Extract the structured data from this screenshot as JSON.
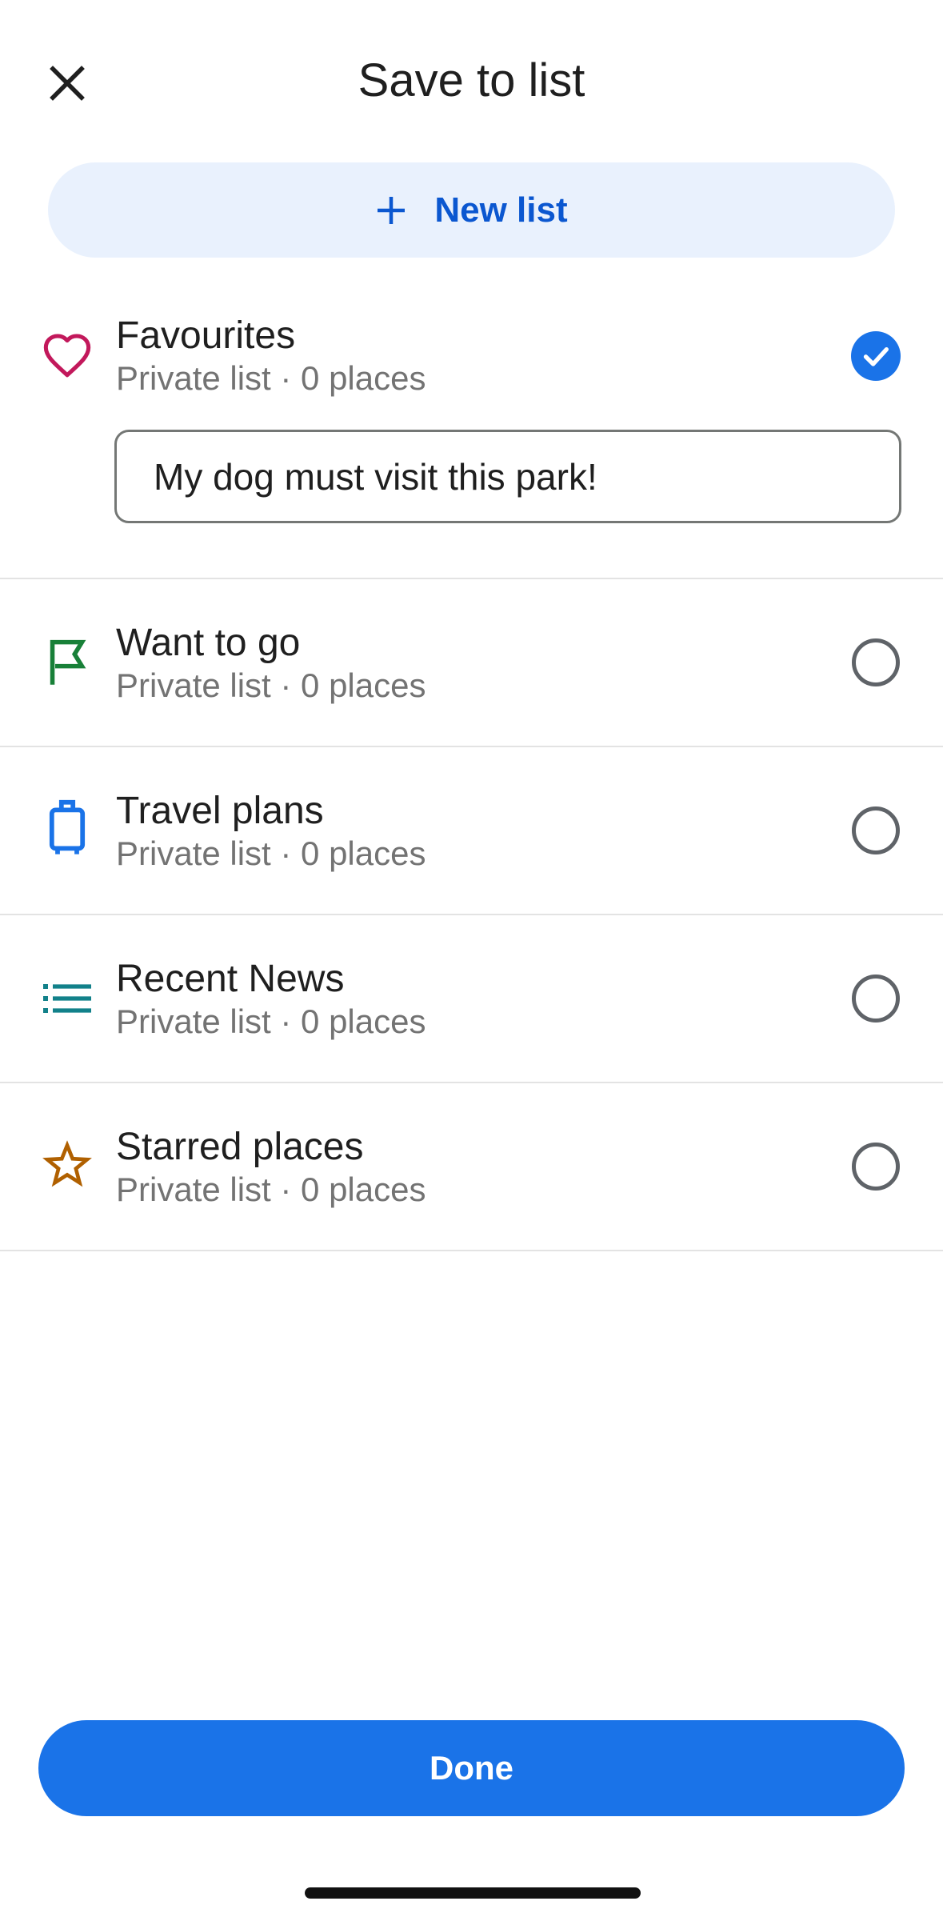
{
  "header": {
    "title": "Save to list",
    "close_icon": "close-icon"
  },
  "new_list": {
    "label": "New list",
    "icon": "plus-icon"
  },
  "lists": [
    {
      "name": "Favourites",
      "subtitle": "Private list · 0 places",
      "icon": "heart-icon",
      "icon_color": "#c2185b",
      "selected": true,
      "note": "My dog must visit this park!"
    },
    {
      "name": "Want to go",
      "subtitle": "Private list · 0 places",
      "icon": "flag-icon",
      "icon_color": "#188038",
      "selected": false
    },
    {
      "name": "Travel plans",
      "subtitle": "Private list · 0 places",
      "icon": "suitcase-icon",
      "icon_color": "#1a73e8",
      "selected": false
    },
    {
      "name": "Recent News",
      "subtitle": "Private list · 0 places",
      "icon": "list-icon",
      "icon_color": "#12818a",
      "selected": false
    },
    {
      "name": "Starred places",
      "subtitle": "Private list · 0 places",
      "icon": "star-icon",
      "icon_color": "#b06000",
      "selected": false
    }
  ],
  "footer": {
    "done_label": "Done"
  },
  "colors": {
    "accent": "#1a73e8",
    "new_list_bg": "#e9f1fd",
    "new_list_text": "#0b57d0"
  }
}
